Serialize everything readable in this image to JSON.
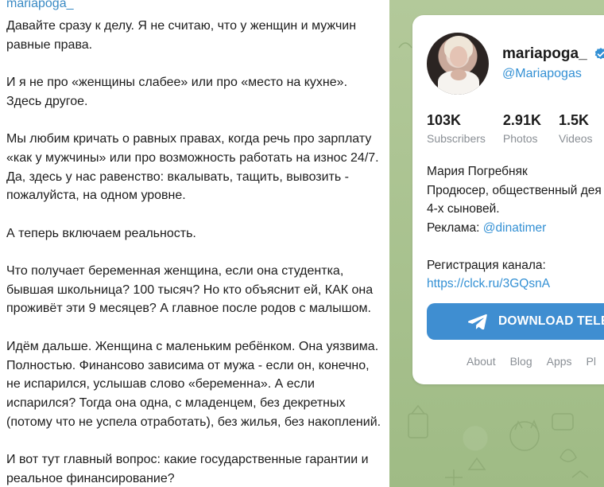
{
  "post": {
    "author": "mariapoga_",
    "paragraphs": [
      "Давайте сразу к делу. Я не считаю, что у женщин и мужчин равные права.",
      "И я не про «женщины слабее» или про «место на кухне». Здесь другое.",
      "Мы любим кричать о равных правах, когда речь про зарплату «как у мужчины» или про возможность работать на износ 24/7. Да, здесь у нас равенство: вкалывать, тащить, вывозить - пожалуйста, на одном уровне.",
      "А теперь включаем реальность.",
      "Что получает беременная женщина, если она студентка, бывшая школьница? 100 тысяч? Но кто объяснит ей, КАК она проживёт эти 9 месяцев? А главное после родов с малышом.",
      "Идём дальше. Женщина с маленьким ребёнком. Она уязвима. Полностью. Финансово зависима от мужа - если он, конечно, не испарился, услышав слово «беременна». А если испарился? Тогда она одна, с младенцем, без декретных (потому что не успела отработать), без жилья, без накоплений.",
      "И вот тут главный вопрос: какие государственные гарантии и реальное финансирование?"
    ]
  },
  "channel": {
    "name": "mariapoga_",
    "username": "@Mariapogas",
    "stats": [
      {
        "value": "103K",
        "label": "Subscribers"
      },
      {
        "value": "2.91K",
        "label": "Photos"
      },
      {
        "value": "1.5K",
        "label": "Videos"
      }
    ],
    "desc_name": "Мария Погребняк",
    "desc_line1": "Продюсер, общественный дея",
    "desc_line2": "4-х сыновей.",
    "ad_label": "Реклама: ",
    "ad_link": "@dinatimer",
    "reg_label": "Регистрация канала:",
    "reg_link": "https://clck.ru/3GQsnA",
    "download_label": "DOWNLOAD TELEG",
    "footer": [
      "About",
      "Blog",
      "Apps",
      "Pl"
    ]
  },
  "colors": {
    "link": "#3390d4",
    "button": "#3f8ed1",
    "wallpaper": "#a9c18f"
  },
  "icons": [
    "verified-icon",
    "telegram-plane-icon"
  ]
}
